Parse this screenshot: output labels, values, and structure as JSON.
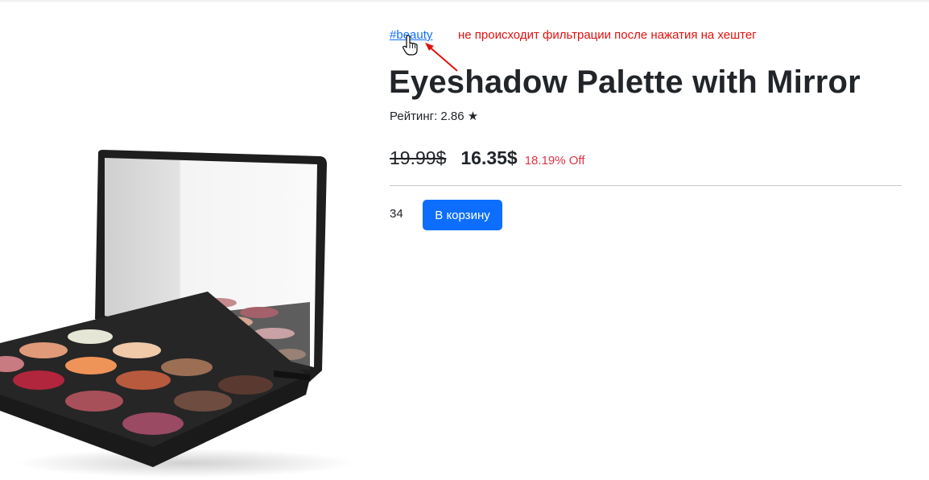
{
  "product": {
    "tag": "#beauty",
    "title": "Eyeshadow Palette with Mirror",
    "rating_text": "Рейтинг: 2.86 ★",
    "old_price": "19.99$",
    "new_price": "16.35$",
    "discount": "18.19% Off",
    "stock": "34",
    "add_to_cart_label": "В корзину",
    "image_subject": "eyeshadow-palette-with-mirror"
  },
  "annotation": {
    "text": "не происходит фильтрации после нажатия на хештег",
    "color": "#e0120f"
  },
  "colors": {
    "link": "#0d6efd",
    "button": "#0d6efd",
    "discount": "#dc3545",
    "text": "#212529"
  }
}
